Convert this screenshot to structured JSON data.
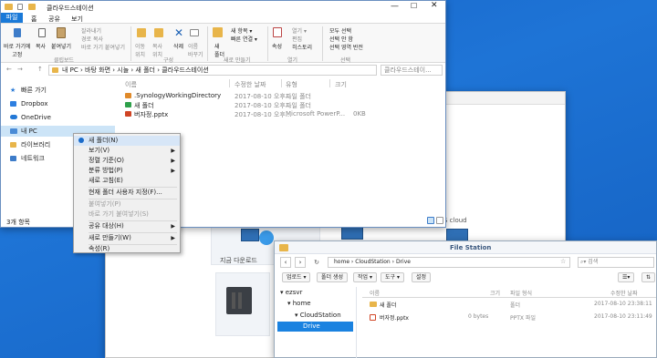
{
  "explorer": {
    "title": "클라우드스테이션",
    "tabs": [
      "파일",
      "홈",
      "공유",
      "보기"
    ],
    "ribbon": {
      "pin": "바로 가기에\n고정",
      "copy": "복사",
      "paste": "붙여넣기",
      "cut": "잘라내기",
      "copy_path": "경로 복사",
      "paste_shortcut": "바로 가기 붙여넣기",
      "move_to": "이동\n위치",
      "copy_to": "복사\n위치",
      "delete": "삭제",
      "rename": "이름\n바꾸기",
      "new_folder": "새\n폴더",
      "new_item": "새 항목 ▾",
      "easy_access": "빠른 연결 ▾",
      "properties": "속성",
      "open": "열기 ▾",
      "edit": "편집",
      "history": "히스토리",
      "select_all": "모두 선택",
      "select_none": "선택 안 함",
      "invert": "선택 영역 반전",
      "group_clipboard": "클립보드",
      "group_organize": "구성",
      "group_new": "새로 만들기",
      "group_open": "열기",
      "group_select": "선택"
    },
    "breadcrumb": [
      "내 PC",
      "바탕 화면",
      "시놀",
      "새 폴더",
      "클라우드스테이션"
    ],
    "search_placeholder": "클라우드스테이...",
    "nav": [
      "빠른 가기",
      "Dropbox",
      "OneDrive",
      "내 PC",
      "라이브러리",
      "네트워크"
    ],
    "columns": [
      "이름",
      "수정한 날짜",
      "유형",
      "크기"
    ],
    "files": [
      {
        "name": ".SynologyWorkingDirectory",
        "date": "2017-08-10 오후...",
        "type": "파일 폴더",
        "size": ""
      },
      {
        "name": "새 폴더",
        "date": "2017-08-10 오후...",
        "type": "파일 폴더",
        "size": ""
      },
      {
        "name": "버자정.pptx",
        "date": "2017-08-10 오후...",
        "type": "Microsoft PowerP...",
        "size": "0KB"
      }
    ],
    "status": "3개 항목"
  },
  "context_menu": {
    "items": [
      {
        "label": "새 폴더(N)",
        "disabled": false,
        "arrow": false,
        "highlight": true
      },
      {
        "label": "보기(V)",
        "disabled": false,
        "arrow": true
      },
      {
        "label": "정렬 기준(O)",
        "disabled": false,
        "arrow": true
      },
      {
        "label": "분류 방법(P)",
        "disabled": false,
        "arrow": true
      },
      {
        "label": "새로 고침(E)",
        "disabled": false,
        "arrow": false
      },
      {
        "label": "현재 폴더 사용자 지정(F)...",
        "disabled": false,
        "arrow": false
      },
      {
        "label": "붙여넣기(P)",
        "disabled": true,
        "arrow": false
      },
      {
        "label": "바로 가기 붙여넣기(S)",
        "disabled": true,
        "arrow": false
      },
      {
        "label": "공유 대상(H)",
        "disabled": false,
        "arrow": true
      },
      {
        "label": "새로 만들기(W)",
        "disabled": false,
        "arrow": true
      },
      {
        "label": "속성(R)",
        "disabled": false,
        "arrow": false
      }
    ]
  },
  "dsm_back": {
    "label_cloud": "S cloud",
    "label_sync": "지금 다운로드"
  },
  "file_station": {
    "title": "File Station",
    "path": [
      "home",
      "CloudStation",
      "Drive"
    ],
    "search_placeholder": "검색",
    "toolbar": [
      "업로드 ▾",
      "폴더 생성",
      "작업 ▾",
      "도구 ▾",
      "설정"
    ],
    "tree": {
      "server": "ezsvr",
      "home": "home",
      "cloud": "CloudStation",
      "drive": "Drive"
    },
    "columns": [
      "이름",
      "크기",
      "파일 형식",
      "수정한 날짜"
    ],
    "files": [
      {
        "name": "새 폴더",
        "size": "",
        "type": "폴더",
        "date": "2017-08-10 23:38:11"
      },
      {
        "name": "버자정.pptx",
        "size": "0 bytes",
        "type": "PPTX 파일",
        "date": "2017-08-10 23:11:49"
      }
    ]
  },
  "colors": {
    "accent": "#1979d8",
    "folder": "#e8b54a",
    "selection": "#cce4f7",
    "fs_selected": "#1a82e0"
  }
}
